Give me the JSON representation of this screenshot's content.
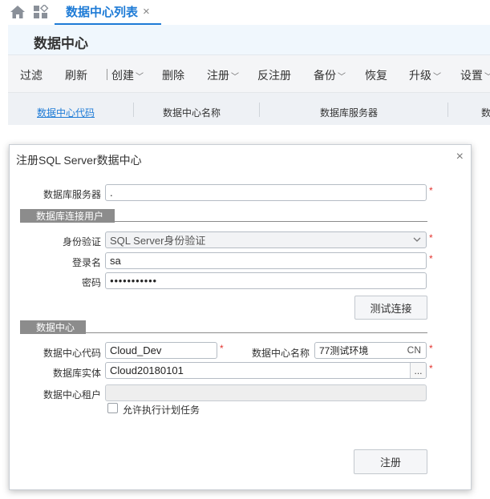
{
  "tabs": {
    "active_label": "数据中心列表",
    "close_glyph": "×"
  },
  "page": {
    "title": "数据中心"
  },
  "toolbar": {
    "filter": "过滤",
    "refresh": "刷新",
    "create": "创建",
    "delete": "删除",
    "register": "注册",
    "unregister": "反注册",
    "backup": "备份",
    "restore": "恢复",
    "upgrade": "升级",
    "settings": "设置"
  },
  "grid": {
    "columns": [
      "数据中心代码",
      "数据中心名称",
      "数据库服务器",
      "数"
    ]
  },
  "dialog": {
    "title": "注册SQL Server数据中心",
    "close_glyph": "×",
    "db_server": {
      "label": "数据库服务器",
      "value": "."
    },
    "section_user": "数据库连接用户",
    "auth": {
      "label": "身份验证",
      "value": "SQL Server身份验证"
    },
    "login": {
      "label": "登录名",
      "value": "sa"
    },
    "password": {
      "label": "密码",
      "value": "●●●●●●●●●●●"
    },
    "test_button": "测试连接",
    "section_dc": "数据中心",
    "dc_code": {
      "label": "数据中心代码",
      "value": "Cloud_Dev"
    },
    "dc_name": {
      "label": "数据中心名称",
      "value": "77测试环境",
      "suffix": "CN"
    },
    "db_entity": {
      "label": "数据库实体",
      "value": "Cloud20180101",
      "button": "..."
    },
    "tenant": {
      "label": "数据中心租户",
      "value": ""
    },
    "allow_schedule": {
      "label": "允许执行计划任务",
      "checked": false
    },
    "register_button": "注册",
    "required_mark": "*"
  },
  "colors": {
    "accent": "#1e7bd6",
    "required": "#e3342f",
    "section_tag": "#8c8c8c"
  }
}
